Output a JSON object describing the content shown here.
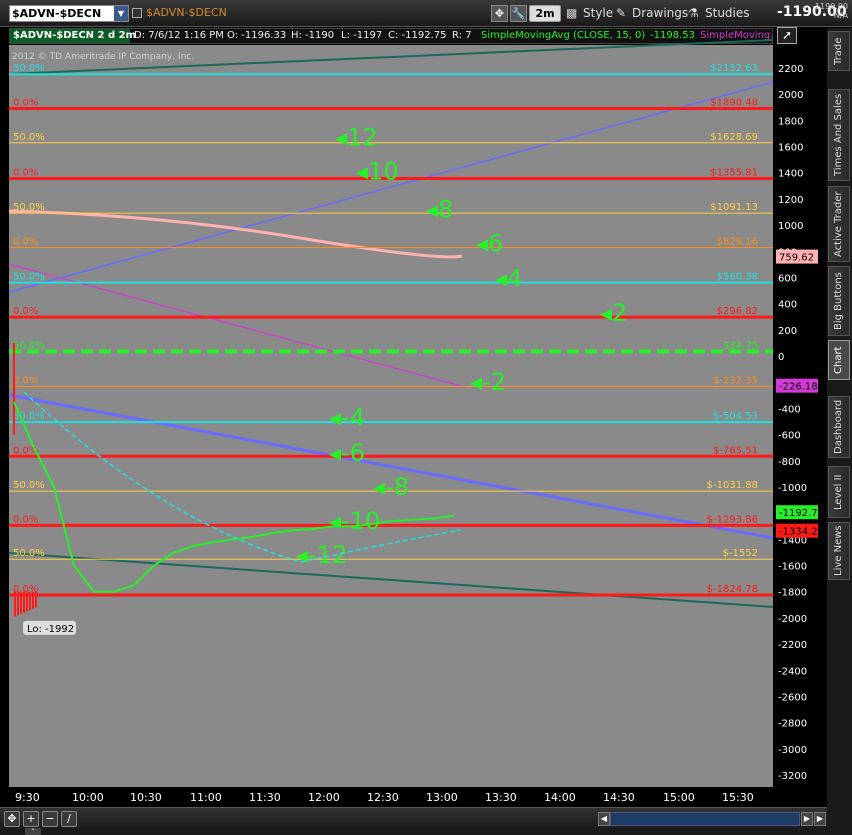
{
  "toolbar": {
    "symbol": "$ADVN-$DECN",
    "chart_symbol": "$ADVN-$DECN",
    "aggregation": "2m",
    "style_label": "Style",
    "drawings_label": "Drawings",
    "studies_label": "Studies",
    "last_price": "-1190.00",
    "last_small_price": "-1190.00",
    "last_small_na": "N/A"
  },
  "info_bar": {
    "title": "$ADVN-$DECN 2 d 2m",
    "date": "D: 7/6/12 1:16 PM",
    "open": "O: -1196.33",
    "high": "H: -1190",
    "low": "L: -1197",
    "close": "C: -1192.75",
    "range": "R: 7",
    "sma_label": "SimpleMovingAvg (CLOSE, 15, 0)",
    "sma_value": "-1198.53",
    "sma2_label": "SimpleMoving..."
  },
  "watermark": "2012 © TD Ameritrade IP Company, Inc.",
  "sidebar": {
    "tabs": [
      "Trade",
      "Times And Sales",
      "Active Trader",
      "Big Buttons",
      "Chart",
      "Dashboard",
      "Level II",
      "Live News"
    ],
    "active": "Chart"
  },
  "colors": {
    "plot_bg": "#8a8a8a",
    "green": "#28f028",
    "red": "#ff1a1a",
    "cyan": "#22e0e0",
    "yellow": "#ffd040",
    "blue": "#6a6aff",
    "magenta": "#d43ad4",
    "teal": "#1b6a5a",
    "pink": "#ffb0b0"
  },
  "chart_data": {
    "type": "line",
    "y_axis": {
      "min": -3300,
      "max": 2300,
      "tick_labels": [
        "2200",
        "2000",
        "1800",
        "1600",
        "1400",
        "1200",
        "1000",
        "800",
        "600",
        "400",
        "200",
        "0",
        "-200",
        "-400",
        "-600",
        "-800",
        "-1000",
        "-1200",
        "-1400",
        "-1600",
        "-1800",
        "-2000",
        "-2200",
        "-2400",
        "-2600",
        "-2800",
        "-3000",
        "-3200"
      ]
    },
    "x_axis": {
      "tick_labels": [
        "9:30",
        "10:00",
        "10:30",
        "11:00",
        "11:30",
        "12:00",
        "12:30",
        "13:00",
        "13:30",
        "14:00",
        "14:30",
        "15:00",
        "15:30"
      ]
    },
    "grid": false,
    "fib_levels": [
      {
        "pct": "50.0%",
        "price": "$2152.63",
        "value": 2152.63,
        "color": "cyan"
      },
      {
        "pct": "0.0%",
        "price": "$1890.48",
        "value": 1890.48,
        "color": "red"
      },
      {
        "pct": "50.0%",
        "price": "$1628.69",
        "value": 1628.69,
        "color": "yellow"
      },
      {
        "pct": "0.0%",
        "price": "$1355.81",
        "value": 1355.81,
        "color": "red"
      },
      {
        "pct": "50.0%",
        "price": "$1091.13",
        "value": 1091.13,
        "color": "yellow"
      },
      {
        "pct": "0.0%",
        "price": "$829.16",
        "value": 829.16,
        "color": "orange"
      },
      {
        "pct": "50.0%",
        "price": "$560.38",
        "value": 560.38,
        "color": "cyan"
      },
      {
        "pct": "0.0%",
        "price": "$296.82",
        "value": 296.82,
        "color": "red"
      },
      {
        "pct": "50.0%",
        "price": "$34.75",
        "value": 34.75,
        "color": "green"
      },
      {
        "pct": "0.0%",
        "price": "$-232.35",
        "value": -232.35,
        "color": "orange"
      },
      {
        "pct": "50.0%",
        "price": "$-504.53",
        "value": -504.53,
        "color": "cyan"
      },
      {
        "pct": "0.0%",
        "price": "$-765.51",
        "value": -765.51,
        "color": "red"
      },
      {
        "pct": "50.0%",
        "price": "$-1031.88",
        "value": -1031.88,
        "color": "yellow"
      },
      {
        "pct": "0.0%",
        "price": "$-1293.86",
        "value": -1293.86,
        "color": "red"
      },
      {
        "pct": "50.0%",
        "price": "$-1552",
        "value": -1552,
        "color": "yellow"
      },
      {
        "pct": "0.0%",
        "price": "$-1824.78",
        "value": -1824.78,
        "color": "red"
      }
    ],
    "wave_labels": [
      {
        "text": "12",
        "value": 1640
      },
      {
        "text": "10",
        "value": 1380
      },
      {
        "text": "8",
        "value": 1090
      },
      {
        "text": "6",
        "value": 830
      },
      {
        "text": "4",
        "value": 560
      },
      {
        "text": "2",
        "value": 300
      },
      {
        "text": "-2",
        "value": -230
      },
      {
        "text": "-4",
        "value": -500
      },
      {
        "text": "-6",
        "value": -770
      },
      {
        "text": "-8",
        "value": -1030
      },
      {
        "text": "-10",
        "value": -1290
      },
      {
        "text": "-12",
        "value": -1550
      }
    ],
    "price_flags": [
      {
        "text": "759.62",
        "value": 759.62,
        "color": "pink"
      },
      {
        "text": "-226.18",
        "value": -226.18,
        "color": "magenta"
      },
      {
        "text": "-1192.75",
        "value": -1192.75,
        "color": "green"
      },
      {
        "text": "-1334.2",
        "value": -1334.2,
        "color": "red"
      }
    ],
    "low_label": "Lo: -1992",
    "low_value": -1992,
    "series": [
      {
        "values": [
          -350,
          -700,
          -1000,
          -1600,
          -1800,
          -1800,
          -1750,
          -1600,
          -1500,
          -1450,
          -1420,
          -1400,
          -1380,
          -1350,
          -1330,
          -1320,
          -1300,
          -1300,
          -1280,
          -1260,
          -1250,
          -1240,
          -1220
        ]
      }
    ]
  }
}
